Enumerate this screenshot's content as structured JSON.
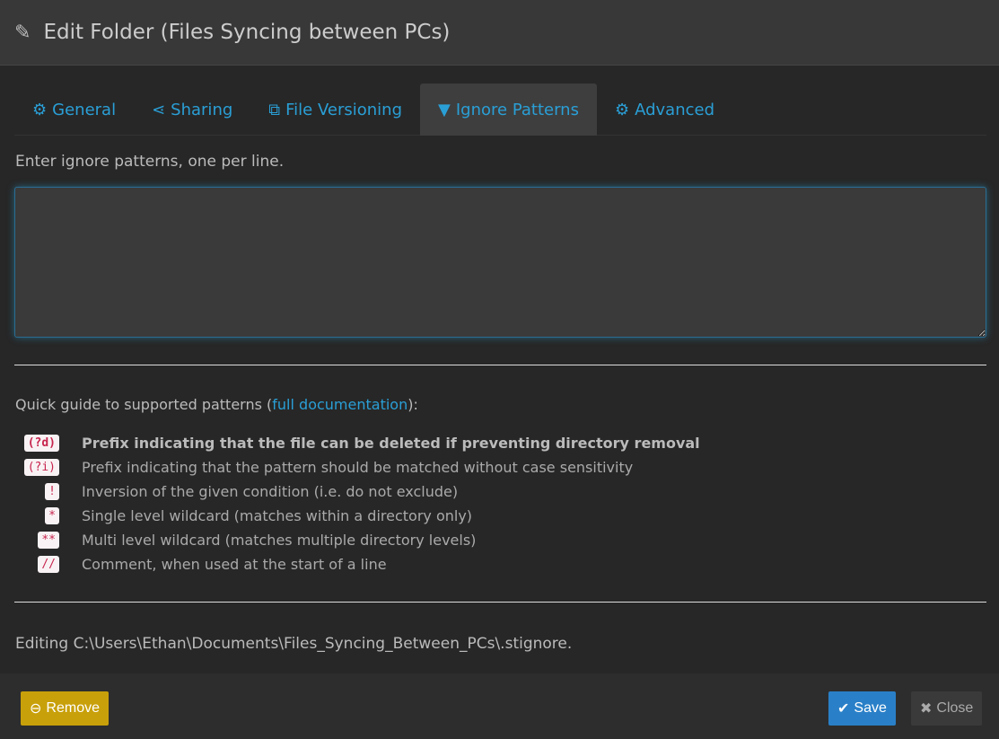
{
  "header": {
    "title": "Edit Folder (Files Syncing between PCs)"
  },
  "tabs": [
    {
      "label": "General",
      "icon": "gear"
    },
    {
      "label": "Sharing",
      "icon": "share"
    },
    {
      "label": "File Versioning",
      "icon": "copy"
    },
    {
      "label": "Ignore Patterns",
      "icon": "filter"
    },
    {
      "label": "Advanced",
      "icon": "gears"
    }
  ],
  "ignore": {
    "label": "Enter ignore patterns, one per line.",
    "value": ""
  },
  "guide": {
    "prefix": "Quick guide to supported patterns (",
    "link": "full documentation",
    "suffix": "):",
    "items": [
      {
        "code": "(?d)",
        "text": "Prefix indicating that the file can be deleted if preventing directory removal"
      },
      {
        "code": "(?i)",
        "text": "Prefix indicating that the pattern should be matched without case sensitivity"
      },
      {
        "code": "!",
        "text": "Inversion of the given condition (i.e. do not exclude)"
      },
      {
        "code": "*",
        "text": "Single level wildcard (matches within a directory only)"
      },
      {
        "code": "**",
        "text": "Multi level wildcard (matches multiple directory levels)"
      },
      {
        "code": "//",
        "text": "Comment, when used at the start of a line"
      }
    ]
  },
  "editing": "Editing C:\\Users\\Ethan\\Documents\\Files_Syncing_Between_PCs\\.stignore.",
  "buttons": {
    "remove": "Remove",
    "save": "Save",
    "close": "Close"
  },
  "colors": {
    "accent": "#2a9fd6",
    "warning": "#c8a00a",
    "primary": "#2a80c8"
  }
}
